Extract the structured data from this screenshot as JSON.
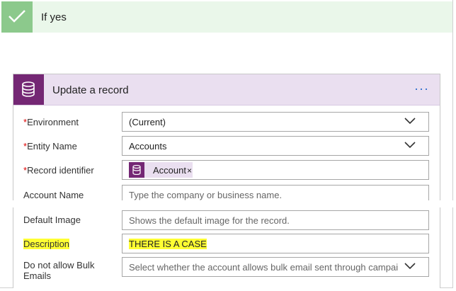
{
  "condition": {
    "title": "If yes",
    "color": "#8cc98c"
  },
  "card": {
    "title": "Update a record",
    "more_label": "···",
    "accent": "#742774"
  },
  "fields": {
    "environment": {
      "label": "Environment",
      "value": "(Current)"
    },
    "entity_name": {
      "label": "Entity Name",
      "value": "Accounts"
    },
    "record_identifier": {
      "label": "Record identifier",
      "token": "Account",
      "token_remove": "×"
    },
    "account_name": {
      "label": "Account Name",
      "placeholder": "Type the company or business name."
    },
    "default_image": {
      "label": "Default Image",
      "placeholder": "Shows the default image for the record."
    },
    "description": {
      "label": "Description",
      "value": "THERE IS A CASE",
      "highlight": "#ffff33"
    },
    "bulk_emails": {
      "label_line1": "Do not allow Bulk",
      "label_line2": "Emails",
      "placeholder": "Select whether the account allows bulk email sent through campaigns. I"
    }
  },
  "required_marker": "*"
}
